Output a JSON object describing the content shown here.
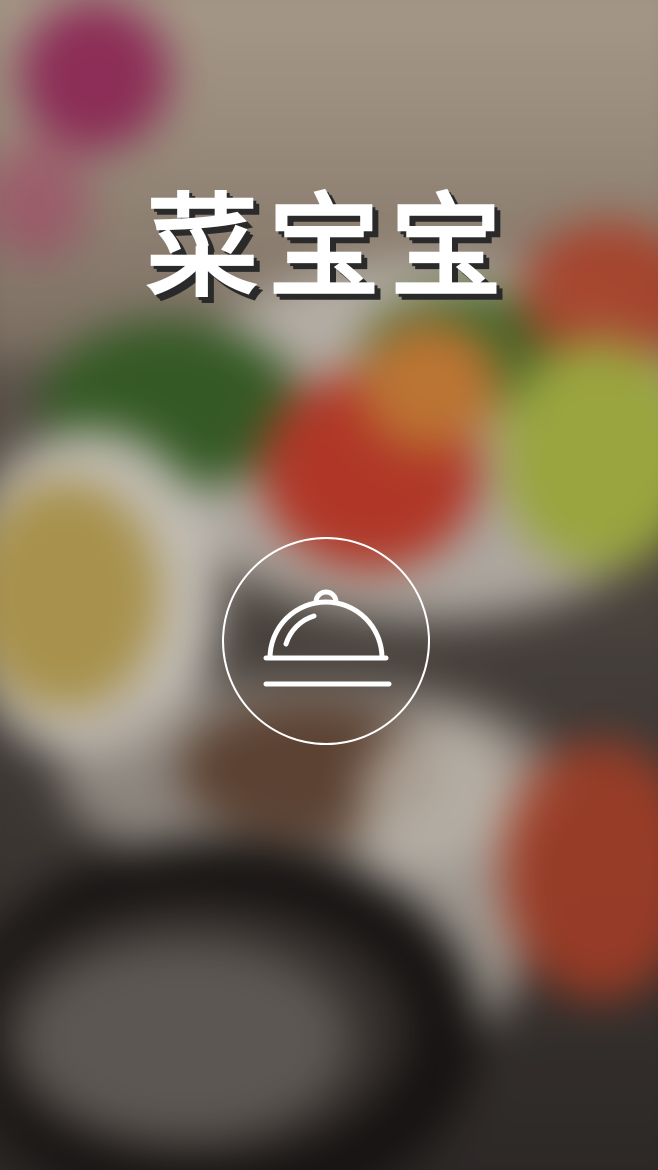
{
  "app": {
    "title": "菜宝宝"
  },
  "logo": {
    "icon": "food-cloche-icon",
    "color": "#ffffff"
  },
  "background": {
    "description_icon": "blurred-food-photo"
  }
}
